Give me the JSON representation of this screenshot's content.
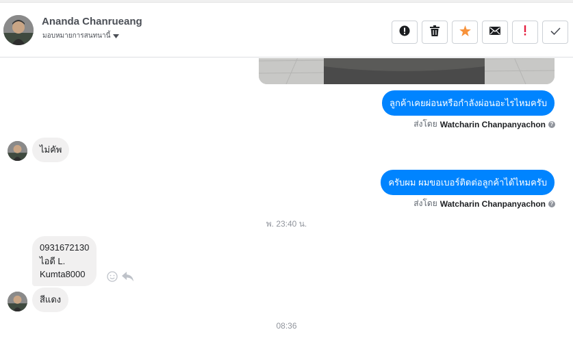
{
  "header": {
    "name": "Ananda Chanrueang",
    "assign_label": "มอบหมายการสนทนานี้"
  },
  "colors": {
    "accent": "#0084ff",
    "star": "#f7923b",
    "alert_red": "#e41e3f"
  },
  "actions": [
    {
      "name": "report-icon"
    },
    {
      "name": "trash-icon"
    },
    {
      "name": "star-icon"
    },
    {
      "name": "mail-icon"
    },
    {
      "name": "exclamation-icon"
    },
    {
      "name": "checkmark-icon"
    }
  ],
  "messages": {
    "out1": "ลูกค้าเคยผ่อนหรือกำลังผ่อนอะไรไหมครับ",
    "in1": "ไม่คัพ",
    "out2": "ครับผม ผมขอเบอร์ติดต่อลูกค้าได้ไหมครับ",
    "in2_line1": "0931672130",
    "in2_line2": "ไอดี  L.",
    "in2_line3": "Kumta8000",
    "in3": "สีแดง"
  },
  "sent_by": {
    "prefix": "ส่งโดย",
    "agent": "Watcharin Chanpanyachon"
  },
  "timestamps": {
    "t1": "พ. 23:40 น.",
    "t2": "08:36"
  }
}
